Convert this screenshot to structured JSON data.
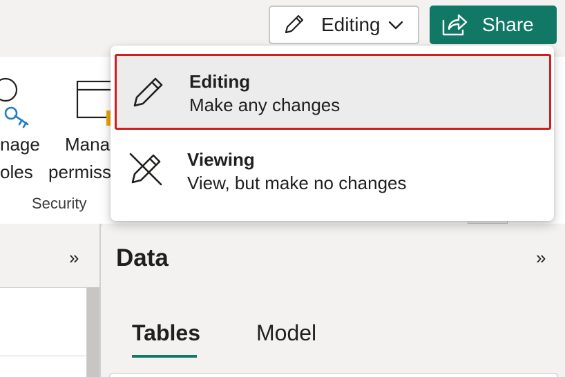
{
  "toolbar": {
    "mode_label": "Editing",
    "share_label": "Share"
  },
  "ribbon": {
    "manage_roles_line1": "nage",
    "manage_roles_line2": "oles",
    "manage_perm_line1": "Mana",
    "manage_perm_line2": "permiss",
    "group_label": "Security"
  },
  "mode_menu": {
    "items": [
      {
        "title": "Editing",
        "description": "Make any changes",
        "icon": "pencil-icon",
        "selected": true
      },
      {
        "title": "Viewing",
        "description": "View, but make no changes",
        "icon": "pencil-crossed-icon",
        "selected": false
      }
    ]
  },
  "data_pane": {
    "title": "Data",
    "tabs": [
      {
        "label": "Tables",
        "active": true
      },
      {
        "label": "Model",
        "active": false
      }
    ]
  },
  "expand_glyph": "»",
  "colors": {
    "accent": "#117865",
    "highlight_border": "#d21d1d",
    "selected_bg": "#ececec"
  }
}
